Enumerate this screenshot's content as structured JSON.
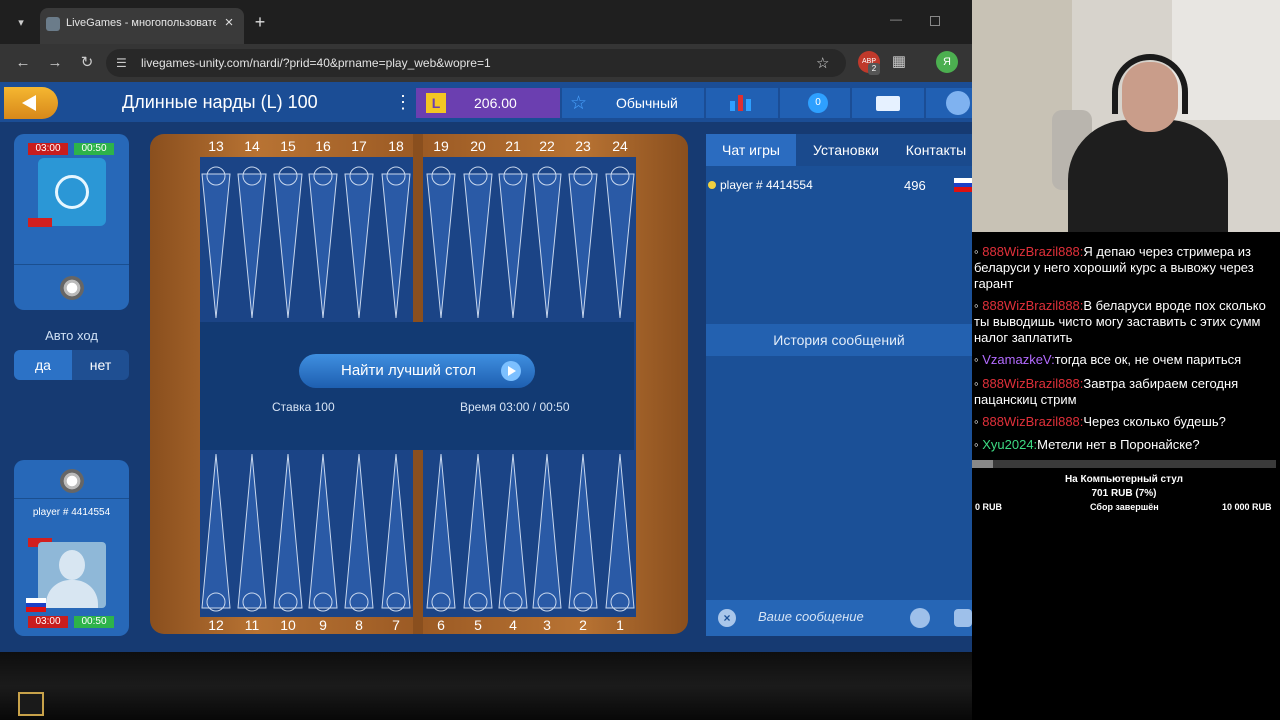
{
  "browser": {
    "tab_title": "LiveGames - многопользовате",
    "url": "livegames-unity.com/nardi/?prid=40&prname=play_web&wopre=1",
    "ext_badge": "2",
    "profile_initial": "Я"
  },
  "game": {
    "title": "Длинные нарды (L) 100",
    "balance": "206.00",
    "level_label": "Обычный",
    "coins": "0",
    "top_numbers": [
      "13",
      "14",
      "15",
      "16",
      "17",
      "18",
      "19",
      "20",
      "21",
      "22",
      "23",
      "24"
    ],
    "bottom_numbers": [
      "12",
      "11",
      "10",
      "9",
      "8",
      "7",
      "6",
      "5",
      "4",
      "3",
      "2",
      "1"
    ],
    "find_table_label": "Найти лучший стол",
    "stake_text": "Ставка 100",
    "time_text": "Время 03:00 / 00:50",
    "opponent": {
      "timer_main": "03:00",
      "timer_move": "00:50"
    },
    "auto_move": {
      "label": "Авто ход",
      "yes": "да",
      "no": "нет"
    },
    "me": {
      "name": "player # 4414554",
      "timer_main": "03:00",
      "timer_move": "00:50"
    }
  },
  "chat_panel": {
    "tabs": [
      "Чат игры",
      "Установки",
      "Контакты"
    ],
    "player_row": {
      "name": "player # 4414554",
      "rating": "496"
    },
    "history_label": "История сообщений",
    "input_placeholder": "Ваше сообщение"
  },
  "stream_chat": {
    "messages": [
      {
        "user": "888WizBrazil888:",
        "color": "#e0303a",
        "text": "Я депаю через стримера из беларуси у него хороший курс а вывожу через гарант"
      },
      {
        "user": "888WizBrazil888:",
        "color": "#e0303a",
        "text": "В беларуси вроде пох сколько ты выводишь чисто могу заставить с этих сумм налог заплатить"
      },
      {
        "user": "VzamazkeV:",
        "color": "#b36bff",
        "text": "тогда все ок, не очем париться"
      },
      {
        "user": "888WizBrazil888:",
        "color": "#e0303a",
        "text": "Завтра забираем сегодня пацанскиц стрим"
      },
      {
        "user": "888WizBrazil888:",
        "color": "#e0303a",
        "text": "Через сколько будешь?"
      },
      {
        "user": "Xyu2024:",
        "color": "#3ddc84",
        "text": "Метели нет в Поронайске?"
      }
    ],
    "donation": {
      "title": "На Компьютерный стул",
      "amount": "701 RUB (7%)",
      "progress": 0.07,
      "min": "0 RUB",
      "status": "Сбор завершён",
      "goal": "10 000 RUB"
    }
  }
}
